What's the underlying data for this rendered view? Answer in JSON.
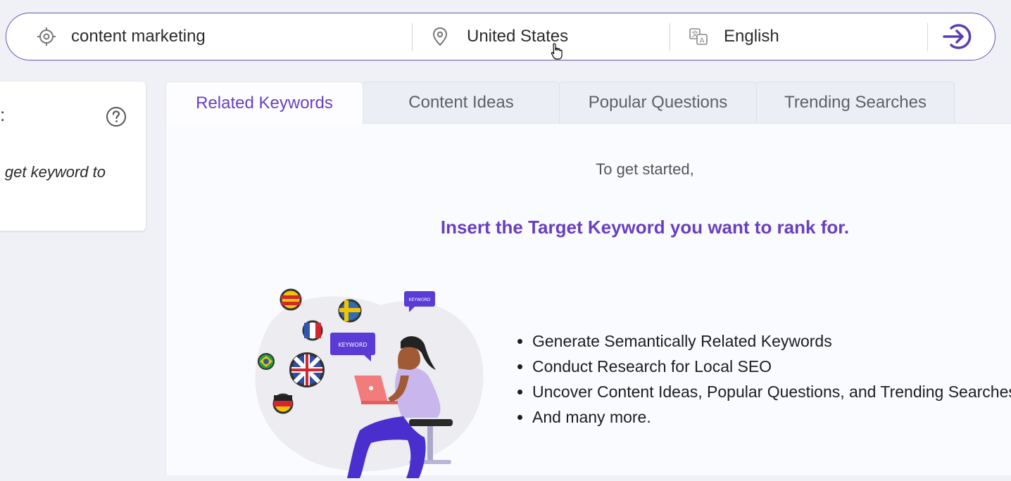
{
  "search": {
    "keyword": "content marketing",
    "location": "United States",
    "language": "English"
  },
  "sidebar": {
    "colon": ":",
    "text": "get keyword to"
  },
  "tabs": [
    {
      "label": "Related Keywords",
      "active": true
    },
    {
      "label": "Content Ideas",
      "active": false
    },
    {
      "label": "Popular Questions",
      "active": false
    },
    {
      "label": "Trending Searches",
      "active": false
    }
  ],
  "main": {
    "intro": "To get started,",
    "headline": "Insert the Target Keyword you want to rank for.",
    "illustration_badge": "KEYWORD",
    "features": [
      "Generate Semantically Related Keywords",
      "Conduct Research for Local SEO",
      "Uncover Content Ideas, Popular Questions, and Trending Searches",
      "And many more."
    ]
  },
  "colors": {
    "accent": "#6a3fbf",
    "border": "#6a4fb6",
    "background": "#f0f1f6"
  },
  "icons": {
    "keyword": "target-icon",
    "location": "map-pin-icon",
    "language": "translate-icon",
    "submit": "arrow-right-circle-icon",
    "help": "help-circle-icon"
  }
}
